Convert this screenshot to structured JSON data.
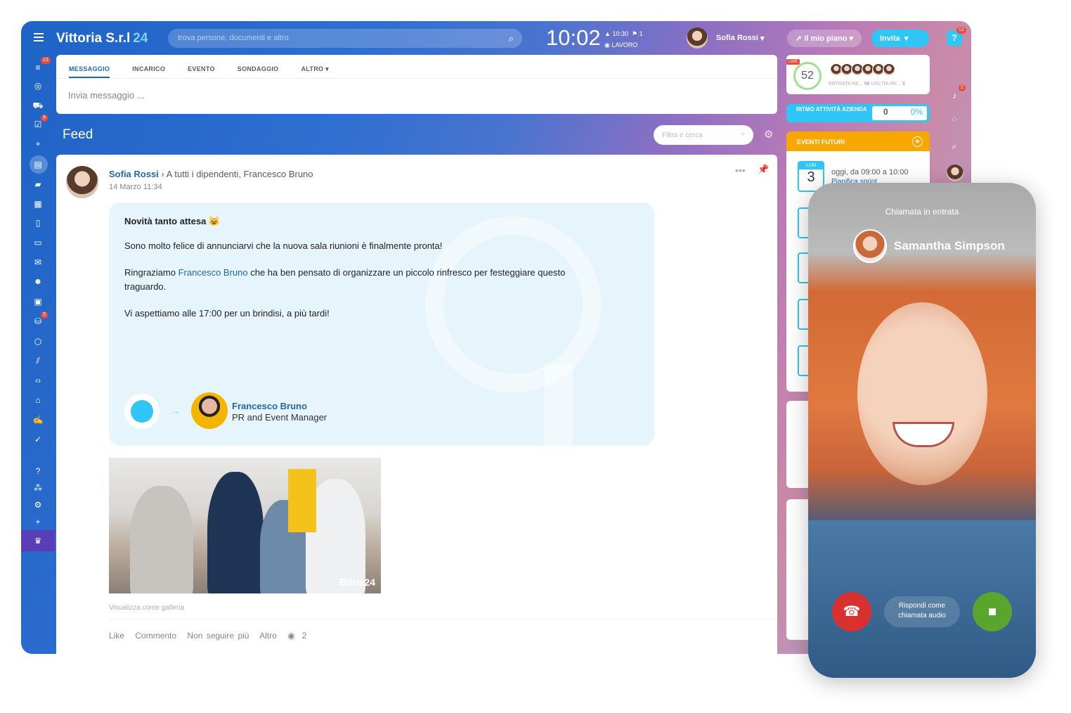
{
  "header": {
    "company": "Vittoria S.r.l",
    "company_suffix": "24",
    "search_placeholder": "trova persone, documenti e altro",
    "clock": "10:02",
    "clock_alarm": "10:30",
    "clock_flag": "1",
    "work_status": "LAVORO",
    "user_name": "Sofia Rossi",
    "plan_label": "Il mio piano",
    "invite_label": "Invita",
    "help_badge": "12"
  },
  "left_nav": {
    "badges": {
      "feed": "13",
      "tasks": "9",
      "sites": "3"
    }
  },
  "right_nav": {
    "notifications_badge": "2"
  },
  "composer": {
    "tabs": [
      "MESSAGGIO",
      "INCARICO",
      "EVENTO",
      "SONDAGGIO",
      "ALTRO"
    ],
    "placeholder": "Invia messaggio ..."
  },
  "feed": {
    "title": "Feed",
    "filter_placeholder": "Filtra e cerca",
    "post": {
      "author": "Sofia Rossi",
      "recipients": "A tutti i dipendenti, Francesco Bruno",
      "date": "14 Marzo 11:34",
      "headline": "Novità tanto attesa 😺",
      "line1": "Sono molto felice di annunciarvi che la nuova sala riunioni è finalmente pronta!",
      "line2_pre": "Ringraziamo",
      "line2_link": "Francesco Bruno",
      "line2_post": "che ha ben pensato di organizzare un piccolo rinfresco per festeggiare questo traguardo.",
      "line3": "Vi aspettiamo alle 17:00 per un brindisi, a più tardi!",
      "mention_name": "Francesco Bruno",
      "mention_role": "PR and Event Manager",
      "watermark": "Bitrix24",
      "gallery_link": "Visualizza come galleria",
      "actions": [
        "Like",
        "Commento",
        "Non seguire più",
        "Altro"
      ],
      "views": "2"
    }
  },
  "right_panel": {
    "live": "LIVE",
    "online_count": "52",
    "entrata_label": "ENTRATA RE...",
    "entrata_count": "56",
    "uscita_label": "USCITA RE...",
    "uscita_count": "3",
    "rhythm_label": "RITMO ATTIVITÀ AZIENDA",
    "rhythm_value": "0",
    "rhythm_percent": "0%",
    "events_title": "EVENTI FUTURI",
    "event_day": "LUN",
    "event_date": "3",
    "event_time": "oggi, da 09:00 a 10:00",
    "event_name": "Pianifica sprint"
  },
  "call": {
    "title": "Chiamata in entrata",
    "caller": "Samantha Simpson",
    "audio_button": "Rispondi come chiamata audio"
  },
  "colors": {
    "accent": "#2fc6f6",
    "link": "#2067b0",
    "events": "#f7a700",
    "decline": "#d8312f",
    "accept": "#5aa62d"
  }
}
